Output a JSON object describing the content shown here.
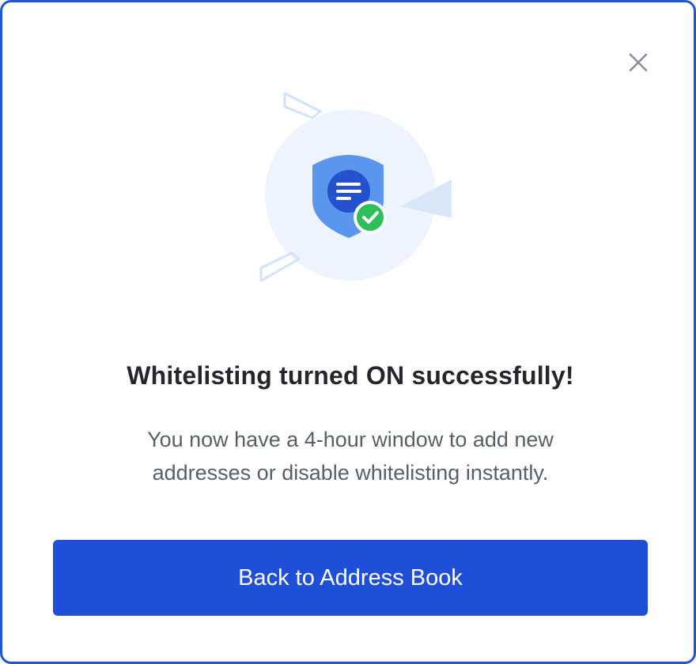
{
  "dialog": {
    "title": "Whitelisting turned ON successfully!",
    "description_lines": [
      "You now have a 4-hour window to add new",
      "addresses or disable whitelisting instantly."
    ],
    "primary_button_label": "Back to Address Book",
    "close_icon": "close-icon",
    "illustration_icon": "shield-checklist-success-icon"
  },
  "colors": {
    "border": "#1f55d6",
    "primary_button": "#1f4ed8",
    "title_text": "#24262c",
    "body_text": "#5a5e67",
    "shield": "#5a95ee",
    "shield_inner": "#2452cf",
    "check_badge": "#2fbf5a",
    "circle_bg": "#eef4fd"
  }
}
